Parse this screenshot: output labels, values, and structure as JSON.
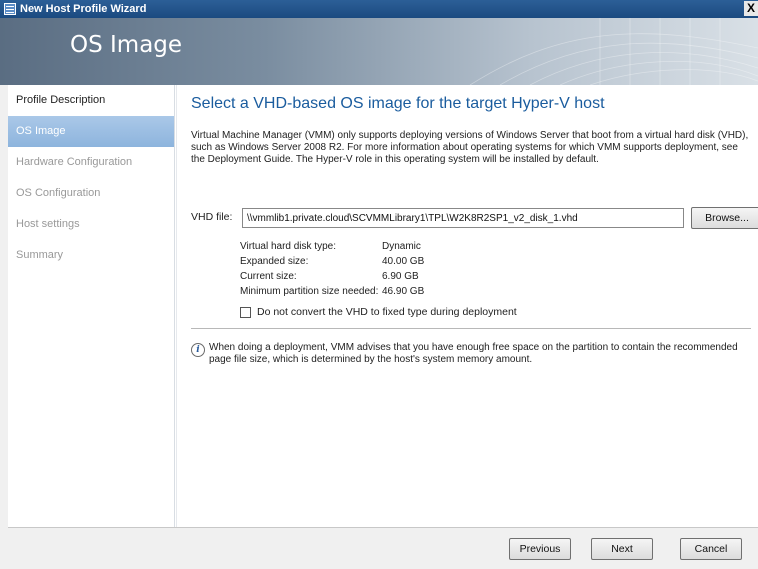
{
  "window": {
    "title": "New Host Profile Wizard",
    "close_label": "X"
  },
  "banner": {
    "title": "OS Image"
  },
  "sidebar": {
    "items": [
      {
        "label": "Profile Description",
        "state": "done"
      },
      {
        "label": "OS Image",
        "state": "active"
      },
      {
        "label": "Hardware Configuration",
        "state": "pending"
      },
      {
        "label": "OS Configuration",
        "state": "pending"
      },
      {
        "label": "Host settings",
        "state": "pending"
      },
      {
        "label": "Summary",
        "state": "pending"
      }
    ]
  },
  "main": {
    "heading": "Select a VHD-based OS image for the target Hyper-V host",
    "description": "Virtual Machine Manager (VMM) only supports deploying versions of Windows Server that boot from a virtual hard disk (VHD), such as Windows Server 2008 R2. For more information about operating systems for which VMM supports deployment, see the Deployment Guide. The Hyper-V role in this operating system will be installed by default.",
    "vhd_label": "VHD file:",
    "vhd_value": "\\\\vmmlib1.private.cloud\\SCVMMLibrary1\\TPL\\W2K8R2SP1_v2_disk_1.vhd",
    "browse_label": "Browse...",
    "details": [
      {
        "key": "Virtual hard disk type:",
        "value": "Dynamic"
      },
      {
        "key": "Expanded size:",
        "value": "40.00 GB"
      },
      {
        "key": "Current size:",
        "value": "6.90 GB"
      },
      {
        "key": "Minimum partition size needed:",
        "value": "46.90 GB"
      }
    ],
    "checkbox_label": "Do not convert the VHD to fixed type during deployment",
    "checkbox_checked": false,
    "note": "When doing a deployment, VMM advises that you have enough free space on the partition to contain the recommended page file size, which is determined by the host's system memory amount."
  },
  "footer": {
    "previous_label": "Previous",
    "next_label": "Next",
    "cancel_label": "Cancel"
  },
  "colors": {
    "heading": "#1a5c9e",
    "active_nav": "#8db4dd",
    "titlebar": "#1b4a80"
  }
}
